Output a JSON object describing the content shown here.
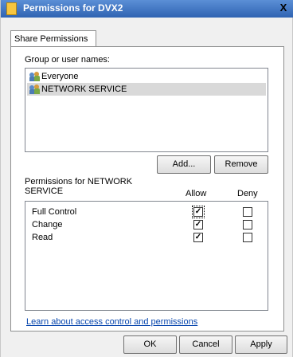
{
  "window": {
    "title": "Permissions for DVX2",
    "close_label": "X"
  },
  "tabs": [
    {
      "label": "Share Permissions",
      "active": true
    }
  ],
  "groups": {
    "label": "Group or user names:",
    "items": [
      {
        "name": "Everyone",
        "icon": "users-icon",
        "selected": false
      },
      {
        "name": "NETWORK SERVICE",
        "icon": "users-icon",
        "selected": true
      }
    ]
  },
  "buttons": {
    "add": "Add...",
    "remove": "Remove",
    "ok": "OK",
    "cancel": "Cancel",
    "apply": "Apply"
  },
  "permissions": {
    "header": "Permissions for NETWORK SERVICE",
    "allow_label": "Allow",
    "deny_label": "Deny",
    "rows": [
      {
        "name": "Full Control",
        "allow": true,
        "deny": false
      },
      {
        "name": "Change",
        "allow": true,
        "deny": false
      },
      {
        "name": "Read",
        "allow": true,
        "deny": false
      }
    ]
  },
  "link": {
    "text": "Learn about access control and permissions"
  },
  "colors": {
    "titlebar": "#2f63b2",
    "link": "#0645ad",
    "selection": "#d9d9d9"
  }
}
